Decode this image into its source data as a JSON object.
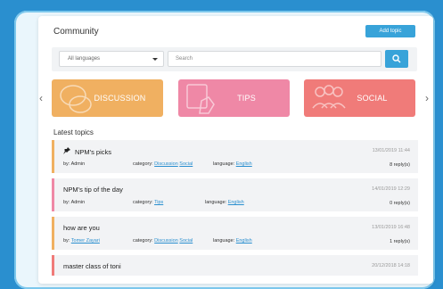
{
  "header": {
    "title": "Community",
    "add_label": "Add topic"
  },
  "filters": {
    "language": "All languages",
    "search_placeholder": "Search"
  },
  "nav": {
    "prev": "‹",
    "next": "›"
  },
  "categories": [
    {
      "label": "DISCUSSION",
      "color": "#f0b061",
      "icon": "chat-bubbles-icon"
    },
    {
      "label": "TIPS",
      "color": "#ef88a6",
      "icon": "tablet-hand-icon"
    },
    {
      "label": "SOCIAL",
      "color": "#f07b79",
      "icon": "people-group-icon"
    }
  ],
  "topics_heading": "Latest topics",
  "labels": {
    "by": "by:",
    "category": "category:",
    "language": "language:"
  },
  "topics": [
    {
      "title": "NPM's picks",
      "pinned": true,
      "author": "Admin",
      "categories": [
        "Discussion",
        "Social"
      ],
      "language": "English",
      "date": "13/01/2019 11:44",
      "replies": "8 reply(s)",
      "accent": "#f0b061"
    },
    {
      "title": "NPM's tip of the day",
      "pinned": false,
      "author": "Admin",
      "categories": [
        "Tips"
      ],
      "language": "English",
      "date": "14/01/2019 12:29",
      "replies": "0 reply(s)",
      "accent": "#ef88a6"
    },
    {
      "title": "how are you",
      "pinned": false,
      "author": "Tomer Zayari",
      "categories": [
        "Discussion",
        "Social"
      ],
      "language": "English",
      "date": "13/01/2019 16:48",
      "replies": "1 reply(s)",
      "accent": "#f0b061"
    },
    {
      "title": "master class of toni",
      "pinned": false,
      "author": "",
      "categories": [],
      "language": "",
      "date": "20/12/2018 14:18",
      "replies": "",
      "accent": "#f07b79"
    }
  ]
}
